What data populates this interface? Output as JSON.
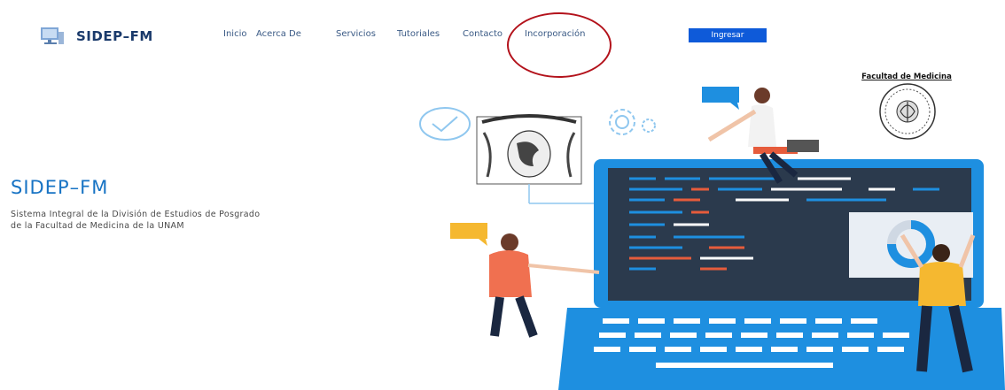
{
  "brand": {
    "name": "SIDEP–FM",
    "logo_icon": "monitor-logo-icon"
  },
  "nav": {
    "items": [
      {
        "label": "Inicio"
      },
      {
        "label": "Acerca De"
      },
      {
        "label": "Servicios"
      },
      {
        "label": "Tutoriales"
      },
      {
        "label": "Contacto"
      },
      {
        "label": "Incorporación"
      }
    ],
    "login_label": "Ingresar"
  },
  "hero": {
    "title": "SIDEP–FM",
    "subtitle_line1": "Sistema Integral de la División de Estudios de Posgrado",
    "subtitle_line2": "de la Facultad de Medicina de la UNAM"
  },
  "illustration": {
    "unam_seal_text": "UNIVERSIDAD NACIONAL AUTONOMA DE MEXICO",
    "fm_seal_title": "Facultad de Medicina"
  },
  "colors": {
    "brand_dark": "#1a3a6b",
    "accent_blue": "#0e5ad9",
    "title_blue": "#1773c4",
    "highlight_red": "#b3121b",
    "laptop_blue": "#1e8fe0",
    "screen_dark": "#2b3a4d"
  }
}
